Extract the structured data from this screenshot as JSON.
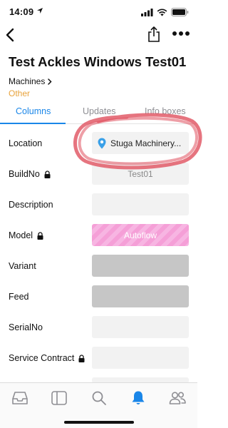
{
  "status": {
    "time": "14:09"
  },
  "page": {
    "title": "Test Ackles Windows Test01",
    "breadcrumb": "Machines",
    "category": "Other"
  },
  "tabs": [
    {
      "label": "Columns",
      "active": true
    },
    {
      "label": "Updates",
      "active": false
    },
    {
      "label": "Info boxes",
      "active": false
    }
  ],
  "fields": [
    {
      "label": "Location",
      "value": "Stuga Machinery...",
      "locked": false,
      "style": "location"
    },
    {
      "label": "BuildNo",
      "value": "Test01",
      "locked": true,
      "style": "text"
    },
    {
      "label": "Description",
      "value": "",
      "locked": false,
      "style": "empty"
    },
    {
      "label": "Model",
      "value": "Autoflow",
      "locked": true,
      "style": "pink"
    },
    {
      "label": "Variant",
      "value": "",
      "locked": false,
      "style": "grey"
    },
    {
      "label": "Feed",
      "value": "",
      "locked": false,
      "style": "grey"
    },
    {
      "label": "SerialNo",
      "value": "",
      "locked": false,
      "style": "empty"
    },
    {
      "label": "Service Contract",
      "value": "",
      "locked": true,
      "style": "empty"
    }
  ],
  "tabbar": {
    "items": [
      "inbox-icon",
      "sidebar-icon",
      "search-icon",
      "bell-icon",
      "people-icon"
    ],
    "active_index": 3
  },
  "colors": {
    "accent": "#1a86e8",
    "category": "#e8a33c",
    "highlight_annotation": "#e0515f"
  }
}
